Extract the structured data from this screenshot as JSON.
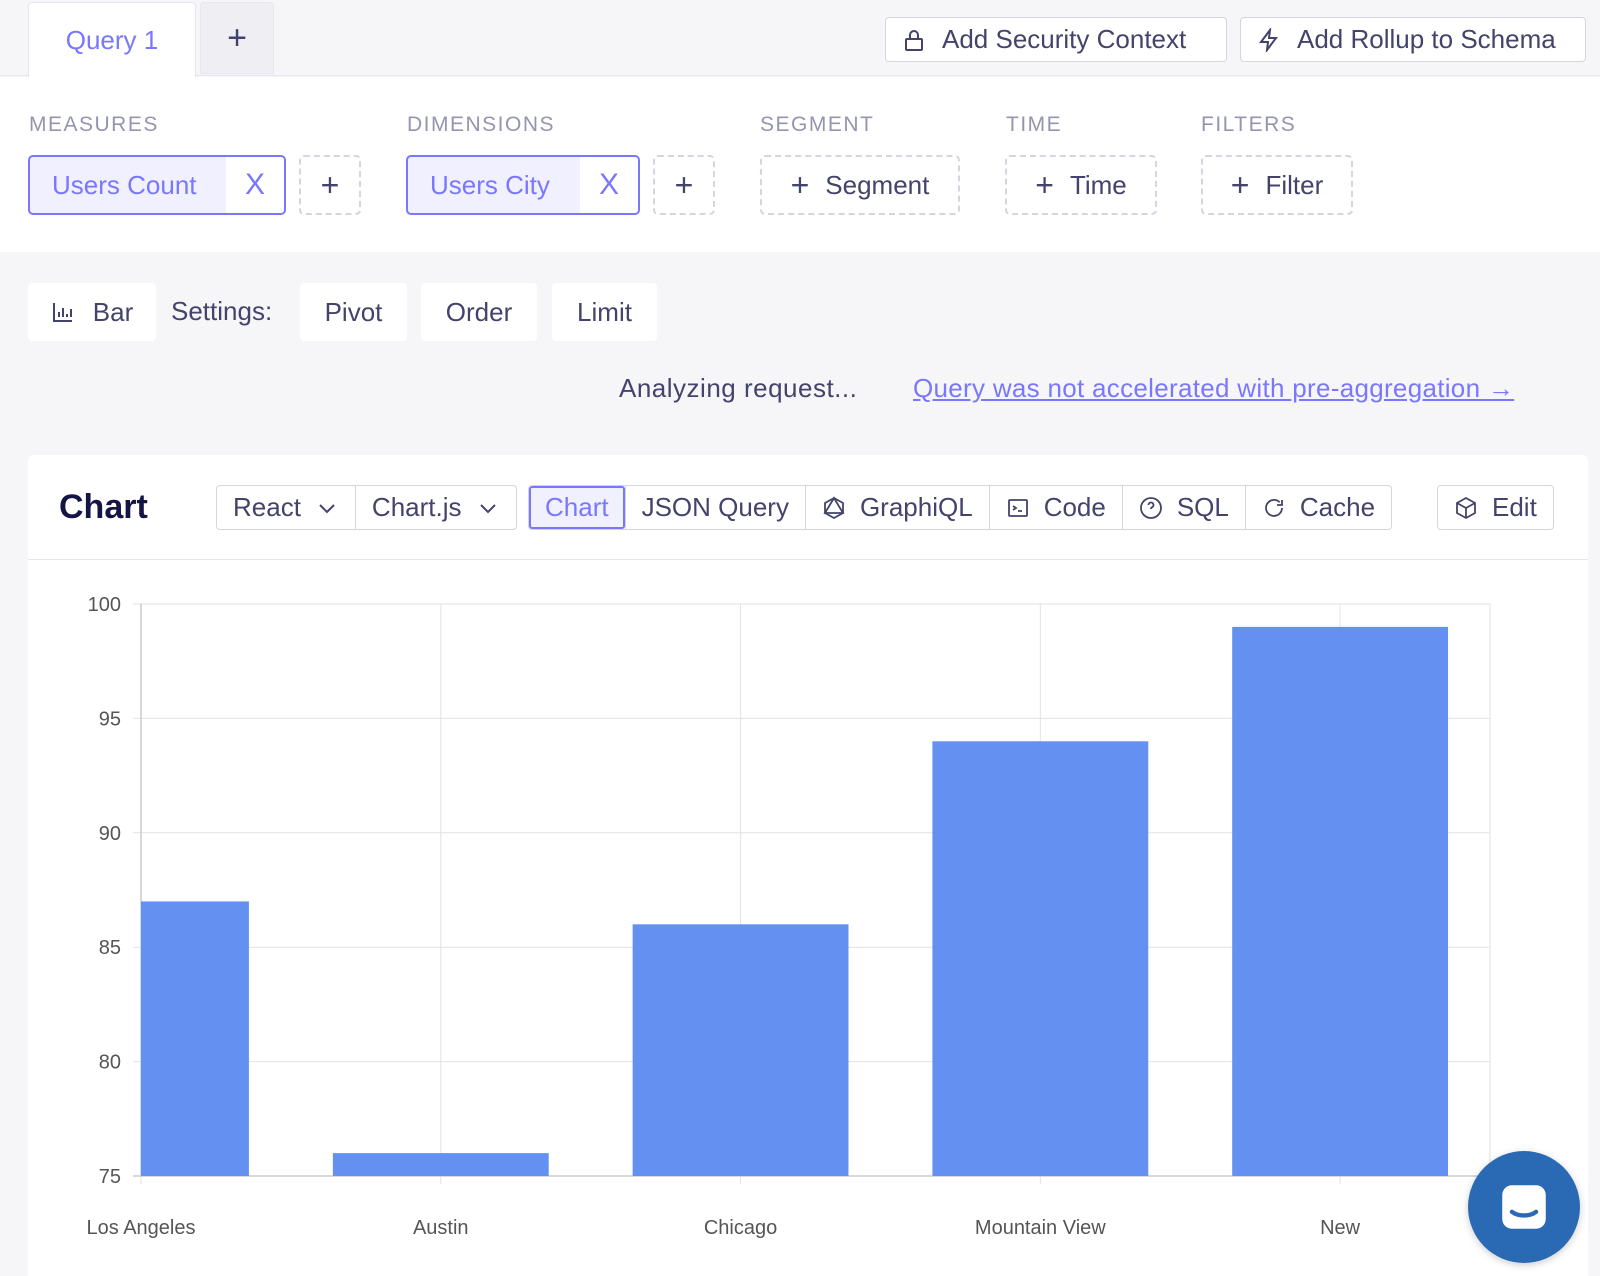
{
  "tabs": {
    "active_label": "Query 1",
    "add_label": "+"
  },
  "toolbar": {
    "security_label": "Add Security Context",
    "rollup_label": "Add Rollup to Schema"
  },
  "members": {
    "measures_label": "MEASURES",
    "dimensions_label": "DIMENSIONS",
    "segment_label": "SEGMENT",
    "time_label": "TIME",
    "filters_label": "FILTERS",
    "measure_pill": "Users Count",
    "dimension_pill": "Users City",
    "remove_glyph": "X",
    "add_glyph": "+",
    "segment_button": "Segment",
    "time_button": "Time",
    "filter_button": "Filter"
  },
  "settings": {
    "chart_type": "Bar",
    "label": "Settings:",
    "pivot": "Pivot",
    "order": "Order",
    "limit": "Limit"
  },
  "status": {
    "analyzing": "Analyzing request...",
    "preagg_link": "Query was not accelerated with pre-aggregation →"
  },
  "card": {
    "title": "Chart",
    "framework": "React",
    "library": "Chart.js",
    "tabs": {
      "chart": "Chart",
      "json_query": "JSON Query",
      "graphiql": "GraphiQL",
      "code": "Code",
      "sql": "SQL",
      "cache": "Cache"
    },
    "edit": "Edit"
  },
  "colors": {
    "accent": "#7a77ff",
    "bar": "#6390f1",
    "chat": "#2a6ab4"
  },
  "chart_data": {
    "type": "bar",
    "categories": [
      "Los Angeles",
      "Austin",
      "Chicago",
      "Mountain View",
      "New"
    ],
    "values": [
      87,
      76,
      86,
      94,
      99
    ],
    "ylim": [
      75,
      100
    ],
    "yticks": [
      75,
      80,
      85,
      90,
      95,
      100
    ],
    "grid": true,
    "title": "",
    "xlabel": "",
    "ylabel": ""
  }
}
